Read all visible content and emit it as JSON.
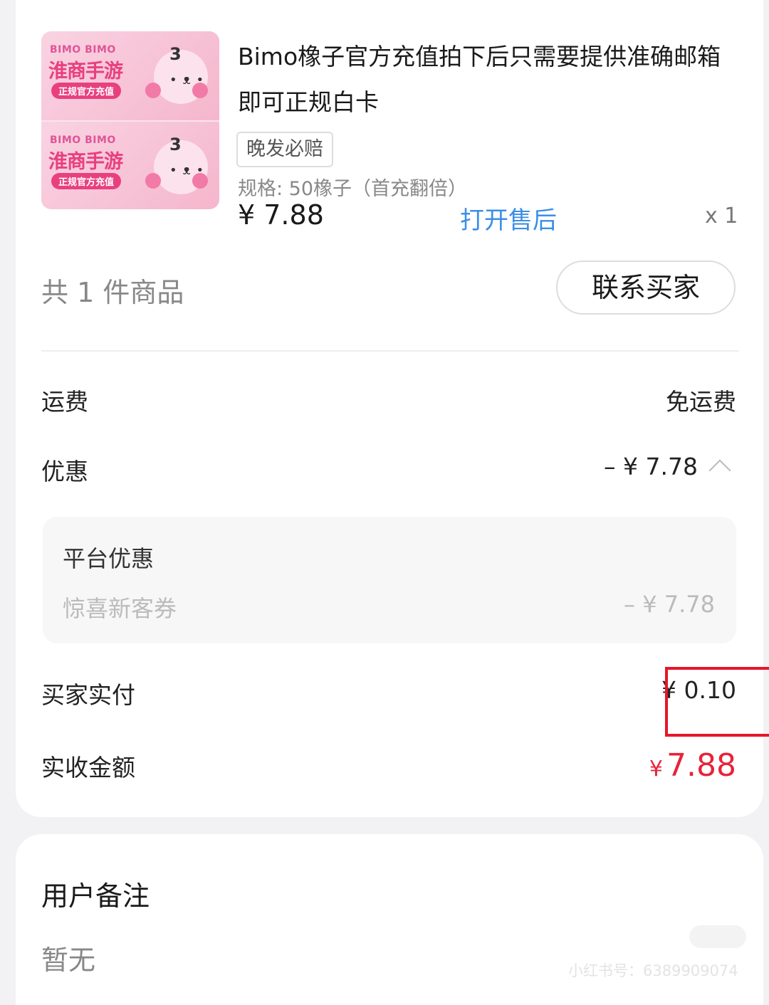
{
  "product": {
    "thumbnail": {
      "brand": "BIMO BIMO",
      "game_text": "淮商手游",
      "tag": "正规官方充值",
      "number": "3"
    },
    "title": "Bimo橡子官方充值拍下后只需要提供准确邮箱即可正规白卡",
    "badge": "晚发必赔",
    "spec": "规格: 50橡子（首充翻倍）",
    "price": "¥ 7.88",
    "after_sale_link": "打开售后",
    "quantity": "x 1"
  },
  "summary": {
    "count_text": "共 1 件商品",
    "contact_button": "联系买家"
  },
  "fees": {
    "shipping_label": "运费",
    "shipping_value": "免运费",
    "discount_label": "优惠",
    "discount_value": "– ¥ 7.78",
    "promo": {
      "title": "平台优惠",
      "name": "惊喜新客券",
      "value": "– ¥ 7.78"
    },
    "paid_label": "买家实付",
    "paid_value": "¥ 0.10",
    "received_label": "实收金额",
    "received_currency": "¥",
    "received_amount": "7.88"
  },
  "note": {
    "title": "用户备注",
    "value": "暂无"
  },
  "watermark": "小红书号：6389909074",
  "colors": {
    "link": "#3b8fe6",
    "accent_red": "#e8233a",
    "highlight_box": "#e8142a"
  }
}
